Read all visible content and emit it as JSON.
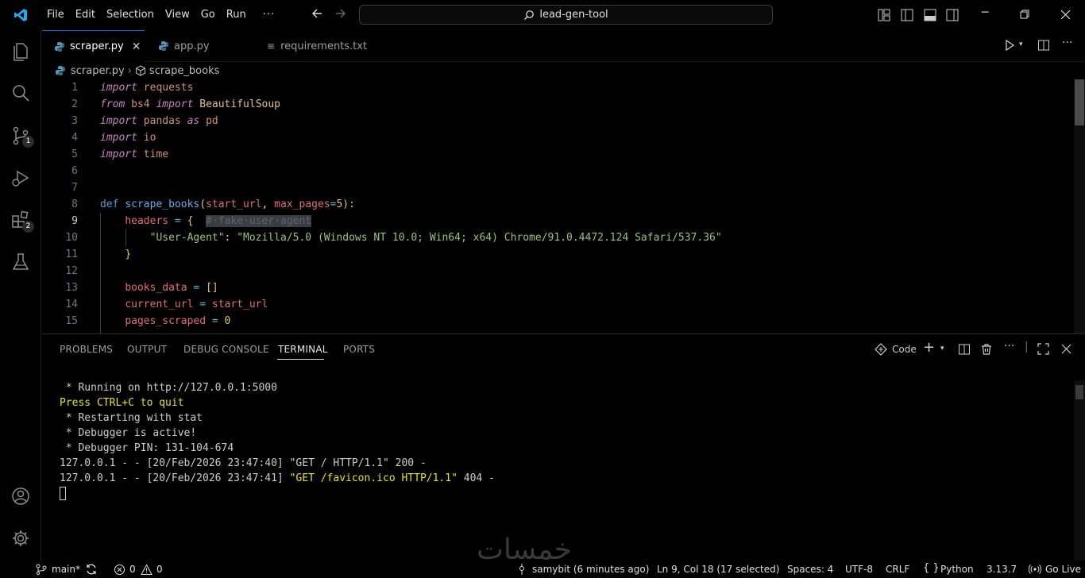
{
  "menu": [
    "File",
    "Edit",
    "Selection",
    "View",
    "Go",
    "Run"
  ],
  "menu_more": "···",
  "command_center": {
    "text": "lead-gen-tool"
  },
  "tabs": [
    {
      "label": "scraper.py",
      "active": true
    },
    {
      "label": "app.py",
      "active": false
    },
    {
      "label": "requirements.txt",
      "active": false
    }
  ],
  "breadcrumb": {
    "file": "scraper.py",
    "symbol": "scrape_books"
  },
  "activity_badges": {
    "source_control": "1",
    "extensions": "2"
  },
  "editor": {
    "line_numbers": [
      "1",
      "2",
      "3",
      "4",
      "5",
      "6",
      "7",
      "8",
      "9",
      "10",
      "11",
      "12",
      "13",
      "14",
      "15"
    ],
    "current_line": "9"
  },
  "code": {
    "l1": {
      "kw": "import",
      "mod": "requests"
    },
    "l2": {
      "kw1": "from",
      "mod": "bs4",
      "kw2": "import",
      "cls": "BeautifulSoup"
    },
    "l3": {
      "kw1": "import",
      "mod": "pandas",
      "kw2": "as",
      "alias": "pd"
    },
    "l4": {
      "kw": "import",
      "mod": "io"
    },
    "l5": {
      "kw": "import",
      "mod": "time"
    },
    "l8": {
      "def": "def",
      "fn": "scrape_books",
      "open": "(",
      "p1": "start_url",
      "comma": ", ",
      "p2": "max_pages",
      "eq": "=",
      "default": "5",
      "close": "):"
    },
    "l9": {
      "var": "headers",
      "eq": " = ",
      "brace": "{",
      "comment": "#·fake·user·agent"
    },
    "l10": {
      "key": "\"User-Agent\"",
      "colon": ": ",
      "val": "\"Mozilla/5.0 (Windows NT 10.0; Win64; x64) Chrome/91.0.4472.124 Safari/537.36\""
    },
    "l11": {
      "brace": "}"
    },
    "l13": {
      "var": "books_data",
      "eq": " = ",
      "val": "[]"
    },
    "l14": {
      "var": "current_url",
      "eq": " = ",
      "val": "start_url"
    },
    "l15": {
      "var": "pages_scraped",
      "eq": " = ",
      "val": "0"
    }
  },
  "panel": {
    "tabs": [
      "PROBLEMS",
      "OUTPUT",
      "DEBUG CONSOLE",
      "TERMINAL",
      "PORTS"
    ],
    "active_tab": "TERMINAL",
    "terminal_profile": "Code"
  },
  "terminal": {
    "lines": [
      " * Running on http://127.0.0.1:5000",
      "Press CTRL+C to quit",
      " * Restarting with stat",
      " * Debugger is active!",
      " * Debugger PIN: 131-104-674",
      "127.0.0.1 - - [20/Feb/2026 23:47:40] \"GET / HTTP/1.1\" 200 -"
    ],
    "last_prefix": "127.0.0.1 - - [20/Feb/2026 23:47:41] ",
    "last_highlight": "\"GET /favicon.ico HTTP/1.1\"",
    "last_suffix": " 404 -"
  },
  "status": {
    "branch": "main*",
    "errors": "0",
    "warnings": "0",
    "blame": "samybit (6 minutes ago)",
    "position": "Ln 9, Col 18 (17 selected)",
    "spaces": "Spaces: 4",
    "encoding": "UTF-8",
    "eol": "CRLF",
    "language": "Python",
    "version": "3.13.7",
    "golive": "Go Live"
  },
  "watermark": "خمسات",
  "colors": {
    "accent": "#0078d4",
    "background": "#000000",
    "python_icon": "#519aba"
  },
  "icons": [
    "vscode-logo-icon",
    "files-icon",
    "search-icon",
    "source-control-icon",
    "run-debug-icon",
    "extensions-icon",
    "testing-icon",
    "account-icon",
    "settings-gear-icon"
  ]
}
